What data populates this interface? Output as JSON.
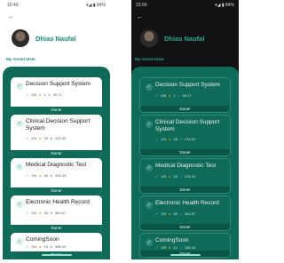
{
  "status_light": {
    "time": "10:43",
    "icons": "◉ ◎ ◑ •",
    "right": "▾◢ ▮ 84%"
  },
  "status_dark": {
    "time": "23:00",
    "icons": "◉ ◎ ◑ •",
    "right": "▾◢ ▮ 84%"
  },
  "back_label": "←",
  "user": {
    "name": "Dhias Naufal"
  },
  "section_label": "My recent tests",
  "cards": [
    {
      "title": "Decision Support System",
      "score": "6/6",
      "coins": "1",
      "points": "99.17",
      "action": "Done!"
    },
    {
      "title": "Clinical Decision Support System",
      "score": "4/3",
      "coins": "28",
      "points": "478.33",
      "action": "Done!"
    },
    {
      "title": "Medical Diagnostic Test",
      "score": "3/5",
      "coins": "28",
      "points": "378.33",
      "action": "Done!"
    },
    {
      "title": "Electronic Health Record",
      "score": "3/5",
      "coins": "48",
      "points": "361.67",
      "action": "Done!"
    },
    {
      "title": "ComingSoon",
      "score": "3/5",
      "coins": "14",
      "points": "398.44",
      "action": "Done!"
    }
  ],
  "colors": {
    "accent": "#1b8a78",
    "sheet": "#0f6a58",
    "dark_bg": "#121212"
  },
  "icons": {
    "check": "check-circle-icon",
    "score": "check-icon",
    "coins": "coin-icon",
    "points": "gem-icon",
    "back": "arrow-left-icon"
  }
}
